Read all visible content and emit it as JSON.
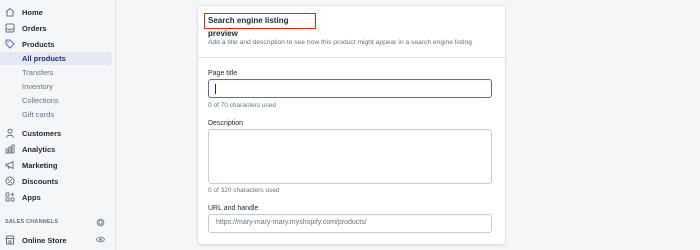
{
  "sidebar": {
    "nav": [
      {
        "label": "Home",
        "icon": "home-icon"
      },
      {
        "label": "Orders",
        "icon": "orders-icon"
      },
      {
        "label": "Products",
        "icon": "tag-icon"
      }
    ],
    "products_sub": [
      {
        "label": "All products",
        "active": true
      },
      {
        "label": "Transfers"
      },
      {
        "label": "Inventory"
      },
      {
        "label": "Collections"
      },
      {
        "label": "Gift cards"
      }
    ],
    "nav2": [
      {
        "label": "Customers",
        "icon": "person-icon"
      },
      {
        "label": "Analytics",
        "icon": "bar-chart-icon"
      },
      {
        "label": "Marketing",
        "icon": "megaphone-icon"
      },
      {
        "label": "Discounts",
        "icon": "discount-icon"
      },
      {
        "label": "Apps",
        "icon": "apps-icon"
      }
    ],
    "sales_channels_title": "SALES CHANNELS",
    "online_store": "Online Store"
  },
  "card": {
    "title": "Search engine listing preview",
    "description": "Add a title and description to see how this product might appear in a search engine listing",
    "page_title_label": "Page title",
    "page_title_value": "",
    "page_title_help": "0 of 70 characters used",
    "description_label": "Description",
    "description_value": "",
    "description_help": "0 of 320 characters used",
    "url_label": "URL and handle",
    "url_value": "https://mary-mary-mary.myshopify.com/products/"
  },
  "colors": {
    "accent": "#5c6ac4",
    "highlight_border": "#d82c0d",
    "active_bg": "#e4e7f4"
  }
}
